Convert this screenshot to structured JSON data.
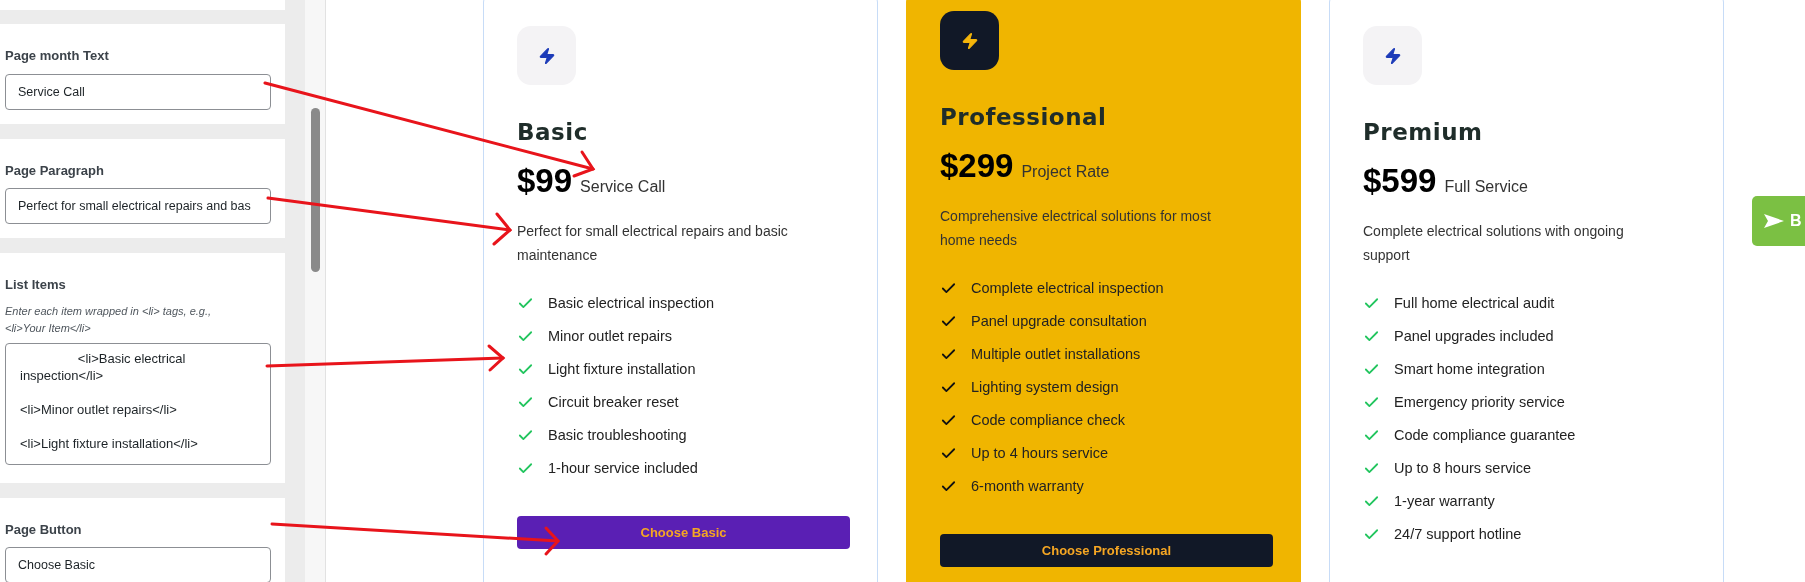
{
  "editor": {
    "fields": [
      {
        "kind": "input",
        "label": "Page month Text",
        "value": "Service Call"
      },
      {
        "kind": "input",
        "label": "Page Paragraph",
        "value": "Perfect for small electrical repairs and bas"
      },
      {
        "kind": "textarea",
        "label": "List Items",
        "hint": "Enter each item wrapped in <li> tags, e.g., <li>Your Item</li>",
        "value": "                <li>Basic electrical inspection</li>\n\n<li>Minor outlet repairs</li>\n\n<li>Light fixture installation</li>"
      },
      {
        "kind": "input",
        "label": "Page Button",
        "value": "Choose Basic"
      }
    ]
  },
  "plans": [
    {
      "name": "Basic",
      "featured": false,
      "price": "$99",
      "period": "Service Call",
      "description": "Perfect for small electrical repairs and basic maintenance",
      "features": [
        "Basic electrical inspection",
        "Minor outlet repairs",
        "Light fixture installation",
        "Circuit breaker reset",
        "Basic troubleshooting",
        "1-hour service included"
      ],
      "button": "Choose Basic"
    },
    {
      "name": "Professional",
      "featured": true,
      "price": "$299",
      "period": "Project Rate",
      "description": "Comprehensive electrical solutions for most home needs",
      "features": [
        "Complete electrical inspection",
        "Panel upgrade consultation",
        "Multiple outlet installations",
        "Lighting system design",
        "Code compliance check",
        "Up to 4 hours service",
        "6-month warranty"
      ],
      "button": "Choose Professional"
    },
    {
      "name": "Premium",
      "featured": false,
      "price": "$599",
      "period": "Full Service",
      "description": "Complete electrical solutions with ongoing support",
      "features": [
        "Full home electrical audit",
        "Panel upgrades included",
        "Smart home integration",
        "Emergency priority service",
        "Code compliance guarantee",
        "Up to 8 hours service",
        "1-year warranty",
        "24/7 support hotline"
      ]
    }
  ],
  "side_button": {
    "label": "B"
  }
}
